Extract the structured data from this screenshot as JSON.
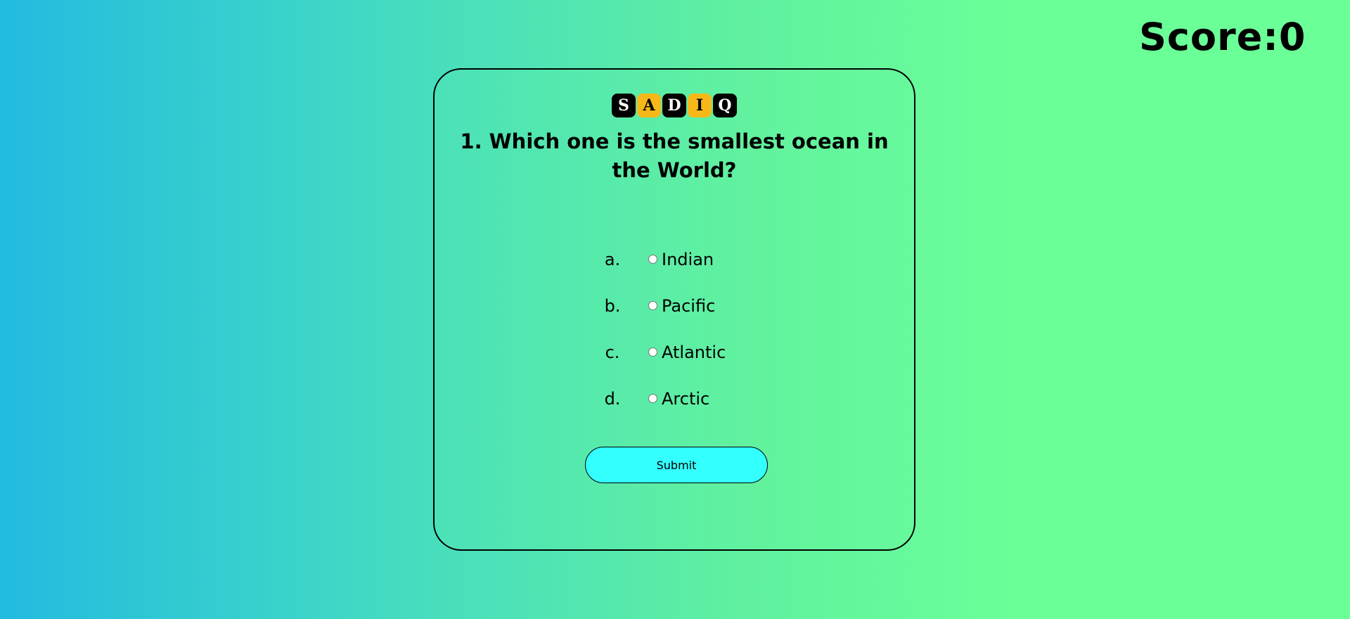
{
  "score": {
    "text": "Score:0"
  },
  "logo": {
    "tiles": [
      {
        "letter": "S",
        "color": "#000000"
      },
      {
        "letter": "A",
        "color": "#f6b818"
      },
      {
        "letter": "D",
        "color": "#000000"
      },
      {
        "letter": "I",
        "color": "#f6b818"
      },
      {
        "letter": "Q",
        "color": "#000000"
      }
    ]
  },
  "quiz": {
    "question": "1. Which one is the smallest ocean in the World?",
    "options": [
      {
        "letter": "a.",
        "label": "Indian",
        "selected": false
      },
      {
        "letter": "b.",
        "label": "Pacific",
        "selected": false
      },
      {
        "letter": "c.",
        "label": "Atlantic",
        "selected": false
      },
      {
        "letter": "d.",
        "label": "Arctic",
        "selected": false
      }
    ],
    "submit_label": "Submit"
  },
  "colors": {
    "submit_bg": "#33ffff",
    "gradient_left": "#22bbe0",
    "gradient_right": "#6bff98"
  }
}
